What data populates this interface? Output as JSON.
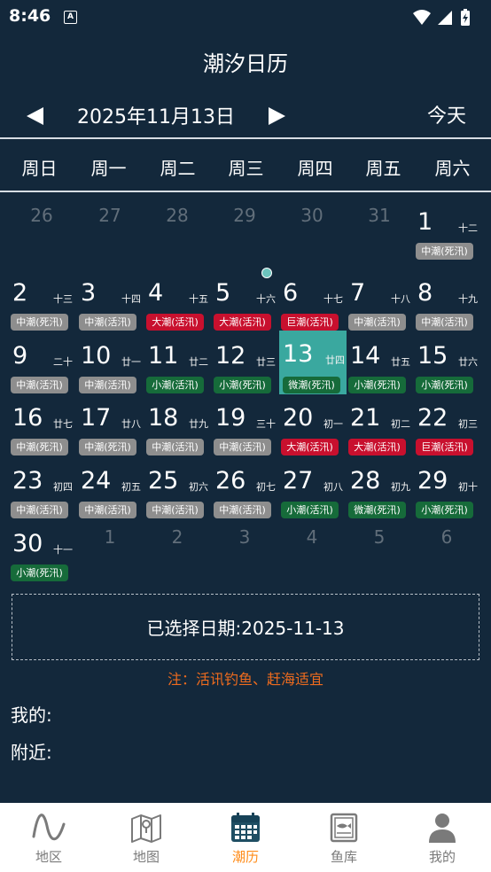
{
  "status_bar": {
    "time": "8:46",
    "notification_icon": "a-letter-icon",
    "icons": [
      "wifi-icon",
      "signal-icon",
      "battery-icon"
    ]
  },
  "header": {
    "title": "潮汐日历"
  },
  "date_nav": {
    "prev_icon": "triangle-left-icon",
    "next_icon": "triangle-right-icon",
    "current": "2025年11月13日",
    "today_label": "今天"
  },
  "weekdays": [
    "周日",
    "周一",
    "周二",
    "周三",
    "周四",
    "周五",
    "周六"
  ],
  "colors": {
    "background": "#13283b",
    "selected": "#3aa89f",
    "gray": "#8e8e8e",
    "red": "#c8102e",
    "green": "#166b3a",
    "note": "#ee6b1e",
    "accent": "#ff8c1a",
    "tab_inactive": "#7a7a7a"
  },
  "calendar": {
    "cells": [
      {
        "day": "26",
        "other": true
      },
      {
        "day": "27",
        "other": true
      },
      {
        "day": "28",
        "other": true
      },
      {
        "day": "29",
        "other": true
      },
      {
        "day": "30",
        "other": true
      },
      {
        "day": "31",
        "other": true
      },
      {
        "day": "1",
        "lunar": "十二",
        "tide": "中潮(死汛)",
        "tone": "gray"
      },
      {
        "day": "2",
        "lunar": "十三",
        "tide": "中潮(死汛)",
        "tone": "gray"
      },
      {
        "day": "3",
        "lunar": "十四",
        "tide": "中潮(活汛)",
        "tone": "gray"
      },
      {
        "day": "4",
        "lunar": "十五",
        "tide": "大潮(活汛)",
        "tone": "red"
      },
      {
        "day": "5",
        "lunar": "十六",
        "tide": "大潮(活汛)",
        "tone": "red",
        "marker": true
      },
      {
        "day": "6",
        "lunar": "十七",
        "tide": "巨潮(活汛)",
        "tone": "red"
      },
      {
        "day": "7",
        "lunar": "十八",
        "tide": "中潮(活汛)",
        "tone": "gray"
      },
      {
        "day": "8",
        "lunar": "十九",
        "tide": "中潮(活汛)",
        "tone": "gray"
      },
      {
        "day": "9",
        "lunar": "二十",
        "tide": "中潮(活汛)",
        "tone": "gray"
      },
      {
        "day": "10",
        "lunar": "廿一",
        "tide": "中潮(活汛)",
        "tone": "gray"
      },
      {
        "day": "11",
        "lunar": "廿二",
        "tide": "小潮(活汛)",
        "tone": "green"
      },
      {
        "day": "12",
        "lunar": "廿三",
        "tide": "小潮(死汛)",
        "tone": "green"
      },
      {
        "day": "13",
        "lunar": "廿四",
        "tide": "微潮(死汛)",
        "tone": "green",
        "selected": true
      },
      {
        "day": "14",
        "lunar": "廿五",
        "tide": "小潮(死汛)",
        "tone": "green"
      },
      {
        "day": "15",
        "lunar": "廿六",
        "tide": "小潮(死汛)",
        "tone": "green"
      },
      {
        "day": "16",
        "lunar": "廿七",
        "tide": "中潮(死汛)",
        "tone": "gray"
      },
      {
        "day": "17",
        "lunar": "廿八",
        "tide": "中潮(死汛)",
        "tone": "gray"
      },
      {
        "day": "18",
        "lunar": "廿九",
        "tide": "中潮(活汛)",
        "tone": "gray"
      },
      {
        "day": "19",
        "lunar": "三十",
        "tide": "中潮(活汛)",
        "tone": "gray"
      },
      {
        "day": "20",
        "lunar": "初一",
        "tide": "大潮(活汛)",
        "tone": "red"
      },
      {
        "day": "21",
        "lunar": "初二",
        "tide": "大潮(活汛)",
        "tone": "red"
      },
      {
        "day": "22",
        "lunar": "初三",
        "tide": "巨潮(活汛)",
        "tone": "red"
      },
      {
        "day": "23",
        "lunar": "初四",
        "tide": "中潮(活汛)",
        "tone": "gray"
      },
      {
        "day": "24",
        "lunar": "初五",
        "tide": "中潮(活汛)",
        "tone": "gray"
      },
      {
        "day": "25",
        "lunar": "初六",
        "tide": "中潮(活汛)",
        "tone": "gray"
      },
      {
        "day": "26",
        "lunar": "初七",
        "tide": "中潮(活汛)",
        "tone": "gray"
      },
      {
        "day": "27",
        "lunar": "初八",
        "tide": "小潮(活汛)",
        "tone": "green"
      },
      {
        "day": "28",
        "lunar": "初九",
        "tide": "微潮(死汛)",
        "tone": "green"
      },
      {
        "day": "29",
        "lunar": "初十",
        "tide": "小潮(死汛)",
        "tone": "green"
      },
      {
        "day": "30",
        "lunar": "十一",
        "tide": "小潮(死汛)",
        "tone": "green"
      },
      {
        "day": "1",
        "other": true
      },
      {
        "day": "2",
        "other": true
      },
      {
        "day": "3",
        "other": true
      },
      {
        "day": "4",
        "other": true
      },
      {
        "day": "5",
        "other": true
      },
      {
        "day": "6",
        "other": true
      }
    ]
  },
  "selection": {
    "text": "已选择日期:2025-11-13"
  },
  "note": "注：活讯钓鱼、赶海适宜",
  "sections": {
    "mine": "我的:",
    "nearby": "附近:"
  },
  "tabs": [
    {
      "label": "地区",
      "icon": "wave-icon",
      "active": false
    },
    {
      "label": "地图",
      "icon": "map-icon",
      "active": false
    },
    {
      "label": "潮历",
      "icon": "calendar-icon",
      "active": true
    },
    {
      "label": "鱼库",
      "icon": "fish-book-icon",
      "active": false
    },
    {
      "label": "我的",
      "icon": "user-icon",
      "active": false
    }
  ]
}
